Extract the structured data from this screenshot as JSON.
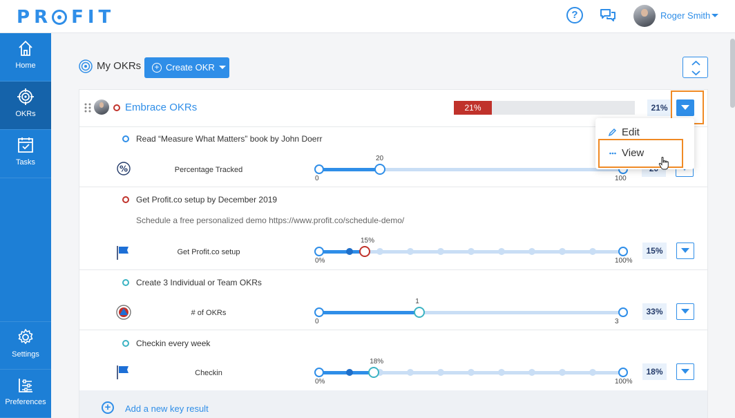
{
  "header": {
    "logo": "PROFIT",
    "user_name": "Roger Smith",
    "help_symbol": "?"
  },
  "sidebar": {
    "items": [
      {
        "label": "Home",
        "icon": "home-icon"
      },
      {
        "label": "OKRs",
        "icon": "target-icon"
      },
      {
        "label": "Tasks",
        "icon": "tasks-icon"
      },
      {
        "label": "Settings",
        "icon": "gear-icon"
      },
      {
        "label": "Preferences",
        "icon": "sliders-icon"
      }
    ],
    "active": "OKRs"
  },
  "page": {
    "title": "My OKRs",
    "create_button": "Create OKR"
  },
  "objective": {
    "title": "Embrace OKRs",
    "progress_label": "21%",
    "progress": 21,
    "status_color": "#c0322b"
  },
  "menu": {
    "items": [
      {
        "label": "Edit",
        "icon": "pencil-icon"
      },
      {
        "label": "View",
        "icon": "dots-icon"
      }
    ]
  },
  "key_results": [
    {
      "title": "Read “Measure What Matters” book by John Doerr",
      "metric": "Percentage Tracked",
      "metric_icon": "percent-icon",
      "status_color": "#2f8ee8",
      "value_label": "20",
      "min_label": "0",
      "max_label": "100",
      "progress": 20,
      "pct_label": "20"
    },
    {
      "title": "Get Profit.co setup by December 2019",
      "description": "Schedule a free personalized demo https://www.profit.co/schedule-demo/",
      "metric": "Get Profit.co setup",
      "metric_icon": "flag-icon",
      "status_color": "#c0322b",
      "value_label": "15%",
      "min_label": "0%",
      "max_label": "100%",
      "progress": 15,
      "pct_label": "15%"
    },
    {
      "title": "Create 3 Individual or Team OKRs",
      "metric": "# of OKRs",
      "metric_icon": "triangle-icon",
      "status_color": "#3bb3c3",
      "value_label": "1",
      "min_label": "0",
      "max_label": "3",
      "progress": 33,
      "pct_label": "33%"
    },
    {
      "title": "Checkin every week",
      "metric": "Checkin",
      "metric_icon": "flag-icon",
      "status_color": "#3bb3c3",
      "value_label": "18%",
      "min_label": "0%",
      "max_label": "100%",
      "progress": 18,
      "pct_label": "18%"
    }
  ],
  "add_key_result": "Add a new key result"
}
